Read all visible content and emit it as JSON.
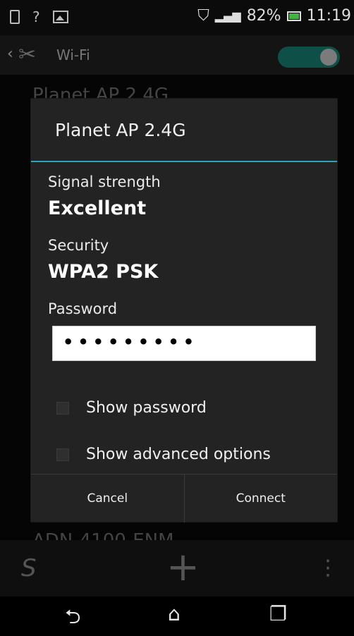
{
  "status_bar": {
    "battery": "82%",
    "time": "11:19"
  },
  "app_bar": {
    "title": "Wi-Fi",
    "wifi_toggle": "on"
  },
  "background_list": {
    "item_top": "Planet AP 2.4G",
    "item_bottom": "ADN-4100-ENM"
  },
  "dialog": {
    "title": "Planet AP 2.4G",
    "signal_label": "Signal strength",
    "signal_value": "Excellent",
    "security_label": "Security",
    "security_value": "WPA2 PSK",
    "password_label": "Password",
    "password_value": "•••••••••",
    "show_password": "Show password",
    "show_advanced": "Show advanced options",
    "cancel": "Cancel",
    "connect": "Connect"
  },
  "colors": {
    "accent": "#2ea4b7",
    "dialog_bg": "#232323"
  }
}
